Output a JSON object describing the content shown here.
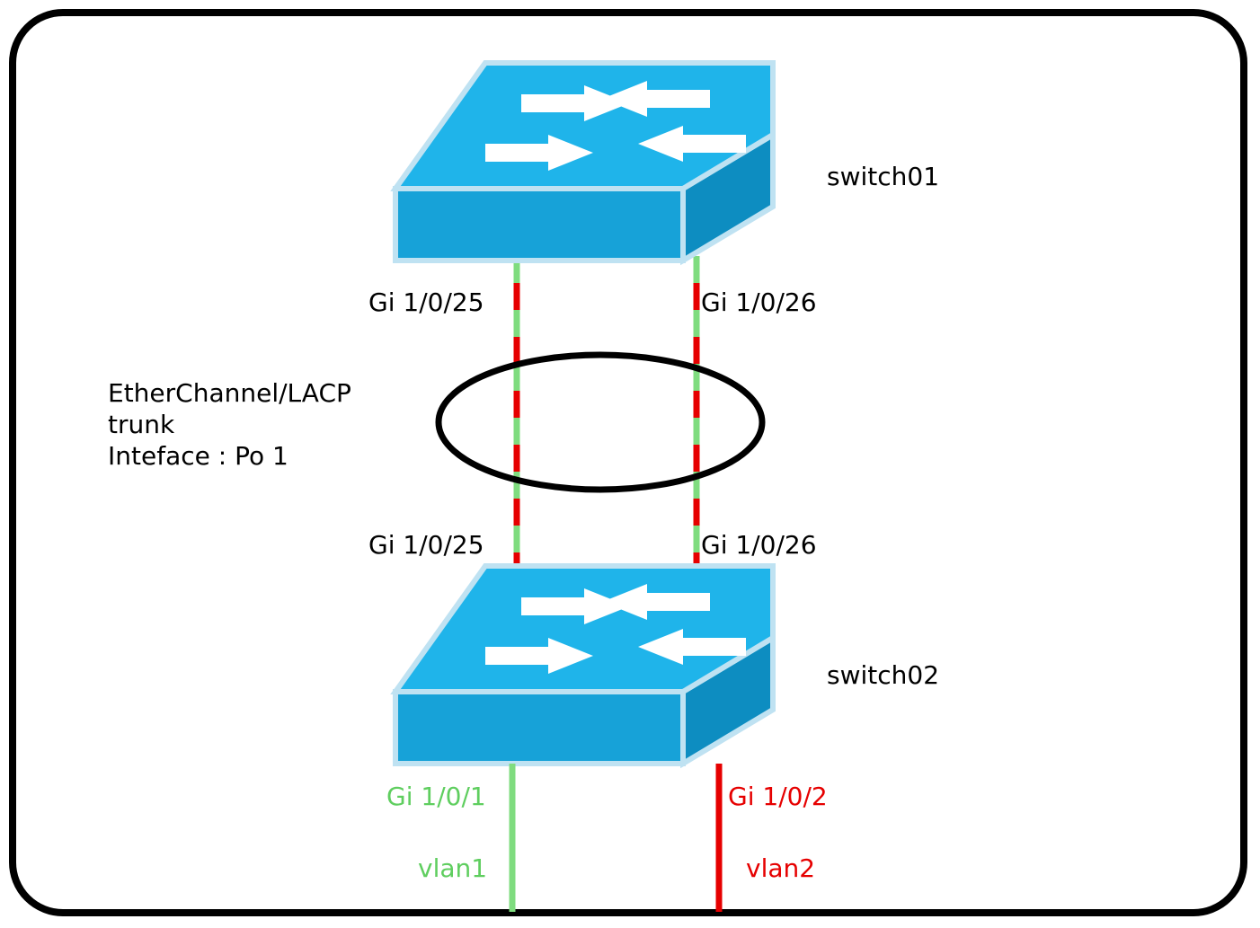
{
  "switches": {
    "top": {
      "name": "switch01"
    },
    "bottom": {
      "name": "switch02"
    }
  },
  "trunk": {
    "title": "EtherChannel/LACP\ntrunk\nInteface : Po 1",
    "top_ports": {
      "left": "Gi 1/0/25",
      "right": "Gi 1/0/26"
    },
    "bottom_ports": {
      "left": "Gi 1/0/25",
      "right": "Gi 1/0/26"
    }
  },
  "access": {
    "left": {
      "port": "Gi 1/0/1",
      "vlan": "vlan1"
    },
    "right": {
      "port": "Gi 1/0/2",
      "vlan": "vlan2"
    }
  }
}
